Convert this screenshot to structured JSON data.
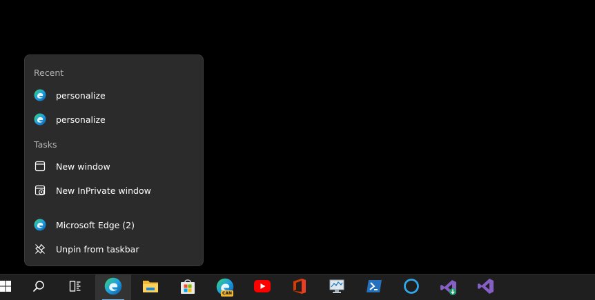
{
  "jumplist": {
    "recent_header": "Recent",
    "recent_items": [
      {
        "label": "personalize",
        "icon": "edge-icon"
      },
      {
        "label": "personalize",
        "icon": "edge-icon"
      }
    ],
    "tasks_header": "Tasks",
    "task_items": [
      {
        "label": "New window",
        "icon": "window-icon"
      },
      {
        "label": "New InPrivate window",
        "icon": "inprivate-window-icon"
      }
    ],
    "app_item": {
      "label": "Microsoft Edge (2)",
      "icon": "edge-icon"
    },
    "unpin_item": {
      "label": "Unpin from taskbar",
      "icon": "unpin-icon"
    }
  },
  "taskbar": {
    "items": [
      {
        "name": "start",
        "icon": "windows-logo-icon"
      },
      {
        "name": "search",
        "icon": "search-icon"
      },
      {
        "name": "task-view",
        "icon": "task-view-icon"
      },
      {
        "name": "microsoft-edge",
        "icon": "edge-icon",
        "active": true
      },
      {
        "name": "file-explorer",
        "icon": "folder-icon"
      },
      {
        "name": "microsoft-store",
        "icon": "store-icon"
      },
      {
        "name": "edge-canary",
        "icon": "edge-canary-icon",
        "badge": "CAN"
      },
      {
        "name": "youtube",
        "icon": "youtube-icon"
      },
      {
        "name": "office",
        "icon": "office-icon"
      },
      {
        "name": "performance-monitor",
        "icon": "monitor-chart-icon"
      },
      {
        "name": "powershell",
        "icon": "powershell-icon"
      },
      {
        "name": "cortana",
        "icon": "cortana-icon"
      },
      {
        "name": "visual-studio-installer",
        "icon": "visual-studio-installer-icon"
      },
      {
        "name": "visual-studio",
        "icon": "visual-studio-icon"
      }
    ]
  },
  "colors": {
    "flyout_bg": "#2b2b2b",
    "taskbar_bg": "#1f1f1f",
    "accent": "#76b9ed",
    "header_text": "#b4b4b4"
  }
}
